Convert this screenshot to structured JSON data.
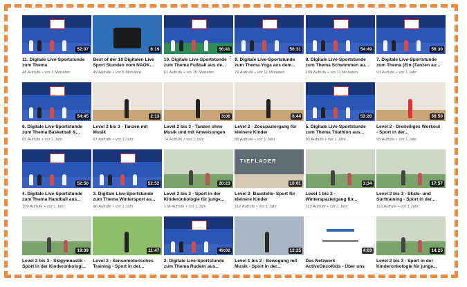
{
  "videos": [
    {
      "title": "11. Digitale Live-Sportstunde zum Thema",
      "views": "48 Aufrufe",
      "age": "vor 3 Monaten",
      "duration": "52:07",
      "thumb": "studio"
    },
    {
      "title": "Best of der 10 Digitalen Live Sport Stunden vom NAOK...",
      "views": "49 Aufrufe",
      "age": "vor 8 Monaten",
      "duration": "6:19",
      "thumb": "camera"
    },
    {
      "title": "10. Digitale Live-Sportstunde zum Thema Fußball aus de...",
      "views": "61 Aufrufe",
      "age": "vor 10 Monaten",
      "duration": "56:41",
      "thumb": "studio-green",
      "menu": "⋮"
    },
    {
      "title": "9. Digitale Live-Sportstunde zum Thema Yoga aus dem...",
      "views": "79 Aufrufe",
      "age": "vor 11 Monaten",
      "duration": "56:31",
      "thumb": "studio"
    },
    {
      "title": "8. Digitale Live-Sportstunde zum Thema Schwimmen au...",
      "views": "109 Aufrufe",
      "age": "vor 11 Monaten",
      "duration": "54:49",
      "thumb": "studio"
    },
    {
      "title": "7. Digitale Live-Sportstunde zum Thema (Ein-)Tanzen au...",
      "views": "93 Aufrufe",
      "age": "vor 1 Jahr",
      "duration": "56:30",
      "thumb": "studio"
    },
    {
      "title": "6. Digitale Live-Sportstunde zum Thema Basketball &...",
      "views": "65 Aufrufe",
      "age": "vor 1 Jahr",
      "duration": "54:45",
      "thumb": "studio"
    },
    {
      "title": "Level 2 bis 3 - Tanzen mit Musik",
      "views": "67 Aufrufe",
      "age": "vor 1 Jahr",
      "duration": "2:13",
      "thumb": "room"
    },
    {
      "title": "Level 2 bis 3 - Tanzen ohne Musik und mit Anweisungen",
      "views": "74 Aufrufe",
      "age": "vor 1 Jahr",
      "duration": "3:06",
      "thumb": "room"
    },
    {
      "title": "Level 2 - Zoospaziergang für kleinere Kinder",
      "views": "88 Aufrufe",
      "age": "vor 1 Jahr",
      "duration": "6:44",
      "thumb": "room-light"
    },
    {
      "title": "5. Digitale Live-Sportstunde zum Thema Triathlon aus...",
      "views": "83 Aufrufe",
      "age": "vor 1 Jahr",
      "duration": "53:20",
      "thumb": "studio"
    },
    {
      "title": "Level 2 - Dreiteiliges Workout - Sport in der...",
      "views": "95 Aufrufe",
      "age": "vor 1 Jahr",
      "duration": "36:50",
      "thumb": "room-red"
    },
    {
      "title": "4. Digitale Live-Sportstunde zum Thema Handball aus...",
      "views": "100 Aufrufe",
      "age": "vor 1 Jahr",
      "duration": "52:50",
      "thumb": "studio"
    },
    {
      "title": "3. Digitale Live-Sportstunde zum Thema Wintersport au...",
      "views": "96 Aufrufe",
      "age": "vor 1 Jahr",
      "duration": "52:52",
      "thumb": "studio"
    },
    {
      "title": "Level 2 bis 3 - Sport in der Kinderonkologie für junge...",
      "views": "178 Aufrufe",
      "age": "vor 1 Jahr",
      "duration": "20:23",
      "thumb": "living"
    },
    {
      "title": "Level 2- Baustelle- Sport für kleinere Kinder",
      "views": "112 Aufrufe",
      "age": "vor 1 Jahr",
      "duration": "10:01",
      "thumb": "tiefl",
      "overlay": "TIEFLADER"
    },
    {
      "title": "Level 1 bis 2 - Winterspaziergang für...",
      "views": "113 Aufrufe",
      "age": "vor 1 Jahr",
      "duration": "3:34",
      "thumb": "living"
    },
    {
      "title": "Level 2 bis 3 - Skate- und Surftraining - Sport in der...",
      "views": "119 Aufrufe",
      "age": "vor 1 Jahr",
      "duration": "17:57",
      "thumb": "living-2"
    },
    {
      "title": "Level 2 bis 3 - Skigymnastik - Sport in der Kinderonkologi...",
      "views": "",
      "age": "",
      "duration": "19:39",
      "thumb": "living"
    },
    {
      "title": "Level 2 - Sensomotorisches Training - Sport in der...",
      "views": "",
      "age": "",
      "duration": "11:47",
      "thumb": "garden"
    },
    {
      "title": "2. Digitale Live-Sportstunde zum Thema Rudern aus...",
      "views": "",
      "age": "",
      "duration": "49:02",
      "thumb": "studio"
    },
    {
      "title": "Level 1 bis 2 - Bewegung mit Musik - Sport in der...",
      "views": "",
      "age": "",
      "duration": "12:25",
      "thumb": "guitar"
    },
    {
      "title": "Das Netzwerk ActiveOncoKids - Über uns",
      "views": "",
      "age": "",
      "duration": "4:03",
      "thumb": "white"
    },
    {
      "title": "Level 2 bis 3 - Sport in der Kinderonkologie für junge...",
      "views": "",
      "age": "",
      "duration": "14:25",
      "thumb": "living-2"
    }
  ],
  "meta_separator": "•",
  "colors": {
    "frame": "#f08a3c",
    "studio": "#1e3f8a",
    "text": "#0f0f0f",
    "meta": "#606060"
  }
}
